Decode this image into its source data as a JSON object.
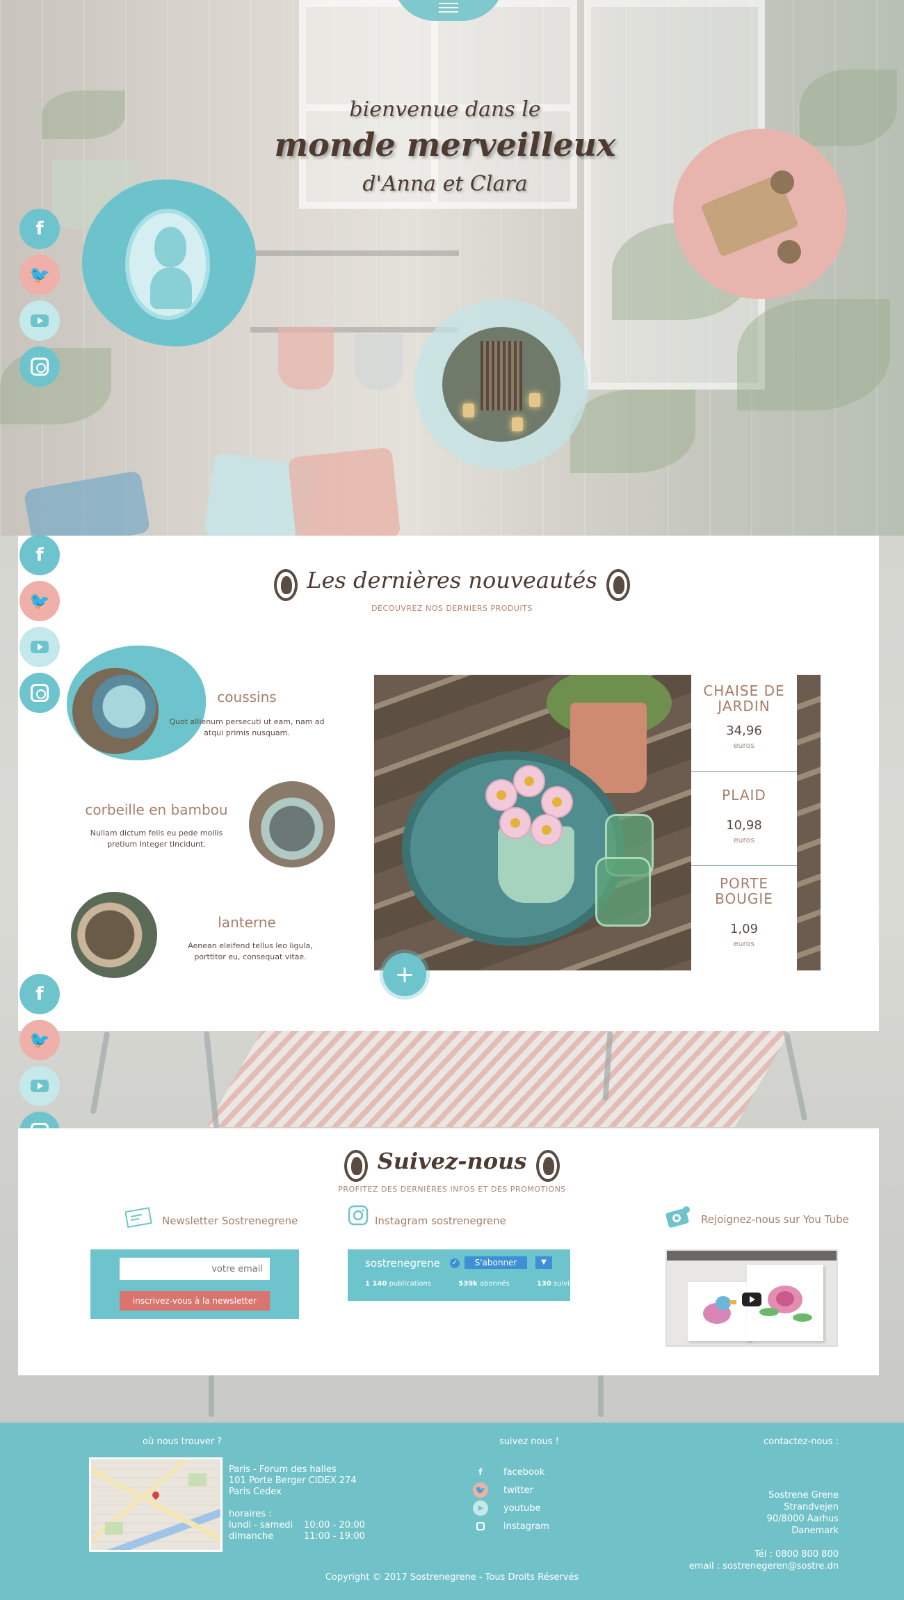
{
  "hero": {
    "line1": "bienvenue dans le",
    "line2": "monde merveilleux",
    "line3": "d'Anna et Clara"
  },
  "social_icons": [
    "facebook-icon",
    "twitter-icon",
    "youtube-icon",
    "instagram-icon"
  ],
  "latest": {
    "title": "Les dernières nouveautés",
    "subtitle": "DÉCOUVREZ NOS DERNIERS PRODUITS",
    "items": [
      {
        "name": "coussins",
        "desc": "Quot allienum persecuti ut eam, nam ad atqui primis nusquam."
      },
      {
        "name": "corbeille en bambou",
        "desc": "Nullam dictum felis eu pede mollis pretium Integer tincidunt."
      },
      {
        "name": "lanterne",
        "desc": "Aenean eleifend tellus leo ligula, porttitor eu, consequat vitae."
      }
    ],
    "prices": [
      {
        "name": "CHAISE DE JARDIN",
        "value": "34,96",
        "unit": "euros"
      },
      {
        "name": "PLAID",
        "value": "10,98",
        "unit": "euros"
      },
      {
        "name": "PORTE BOUGIE",
        "value": "1,09",
        "unit": "euros"
      }
    ],
    "more_label": "+"
  },
  "follow": {
    "title": "Suivez-nous",
    "subtitle": "PROFITEZ DES DERNIÈRES INFOS ET DES PROMOTIONS",
    "newsletter": {
      "title": "Newsletter Sostrenegrene",
      "placeholder": "votre email",
      "button": "inscrivez-vous à la newsletter"
    },
    "instagram": {
      "title": "Instagram sostrenegrene",
      "username": "sostrenegrene",
      "verified": "✓",
      "subscribe": "S'abonner",
      "dropdown": "▼",
      "posts_num": "1 140",
      "posts_label": "publications",
      "followers_num": "539k",
      "followers_label": "abonnés",
      "following_num": "130",
      "following_label": "suivis"
    },
    "youtube": {
      "title": "Rejoignez-nous sur You Tube"
    }
  },
  "footer": {
    "where_title": "où nous trouver ?",
    "address": [
      "Paris - Forum des halles",
      "101 Porte Berger CIDEX 274",
      "Paris Cedex"
    ],
    "hours_title": "horaires :",
    "hours": [
      {
        "day": "lundi - samedi",
        "time": "10:00 - 20:00"
      },
      {
        "day": "dimanche",
        "time": "11:00 - 19:00"
      }
    ],
    "follow_title": "suivez nous !",
    "links": [
      "facebook",
      "twitter",
      "youtube",
      "instagram"
    ],
    "contact_title": "contactez-nous :",
    "contact": [
      "Sostrene Grene",
      "Strandvejen",
      "90/8000 Aarhus",
      "Danemark"
    ],
    "phone": "Tél : 0800 800 800",
    "email": "email : sostrenegeren@sostre.dn",
    "copyright": "Copyright © 2017 Sostrenegrene - Tous Droits Réservés"
  },
  "colors": {
    "accent": "#6ec4cc",
    "pink": "#eeb0a9",
    "brown": "#4d3a30",
    "button_red": "#d9746f"
  }
}
